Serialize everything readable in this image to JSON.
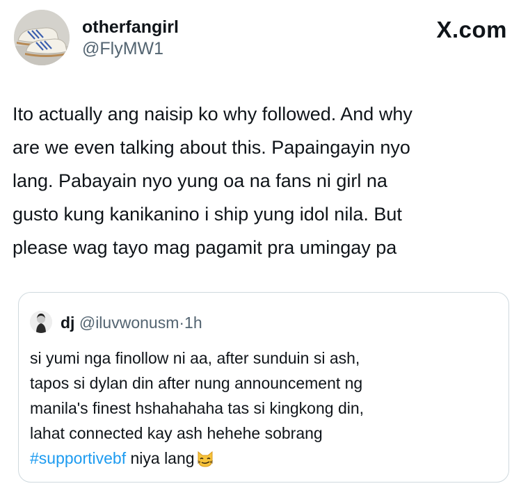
{
  "author": {
    "display_name": "otherfangirl",
    "handle": "@FlyMW1"
  },
  "brand": "X.com",
  "tweet": {
    "lines": [
      "Ito actually ang naisip ko why followed. And why",
      "are we even talking about this. Papaingayin nyo",
      "lang. Pabayain nyo yung oa na fans ni girl na",
      "gusto kung kanikanino i ship yung idol nila. But",
      "please wag tayo mag pagamit pra umingay pa"
    ]
  },
  "quote": {
    "name": "dj",
    "handle": "@iluvwonusm",
    "separator": "·",
    "time": "1h",
    "lines": [
      "si yumi nga finollow ni aa, after sunduin si ash,",
      "tapos si dylan din after nung announcement ng",
      "manila's finest hshahahaha tas si kingkong din,",
      "lahat connected kay ash hehehe sobrang"
    ],
    "hashtag": "#supportivebf",
    "last_line_rest": " niya lang",
    "emoji_icon": "smirking-cat-face-icon"
  },
  "colors": {
    "text": "#0f1419",
    "secondary": "#536471",
    "link": "#1d9bf0",
    "border": "#cfd9de"
  }
}
